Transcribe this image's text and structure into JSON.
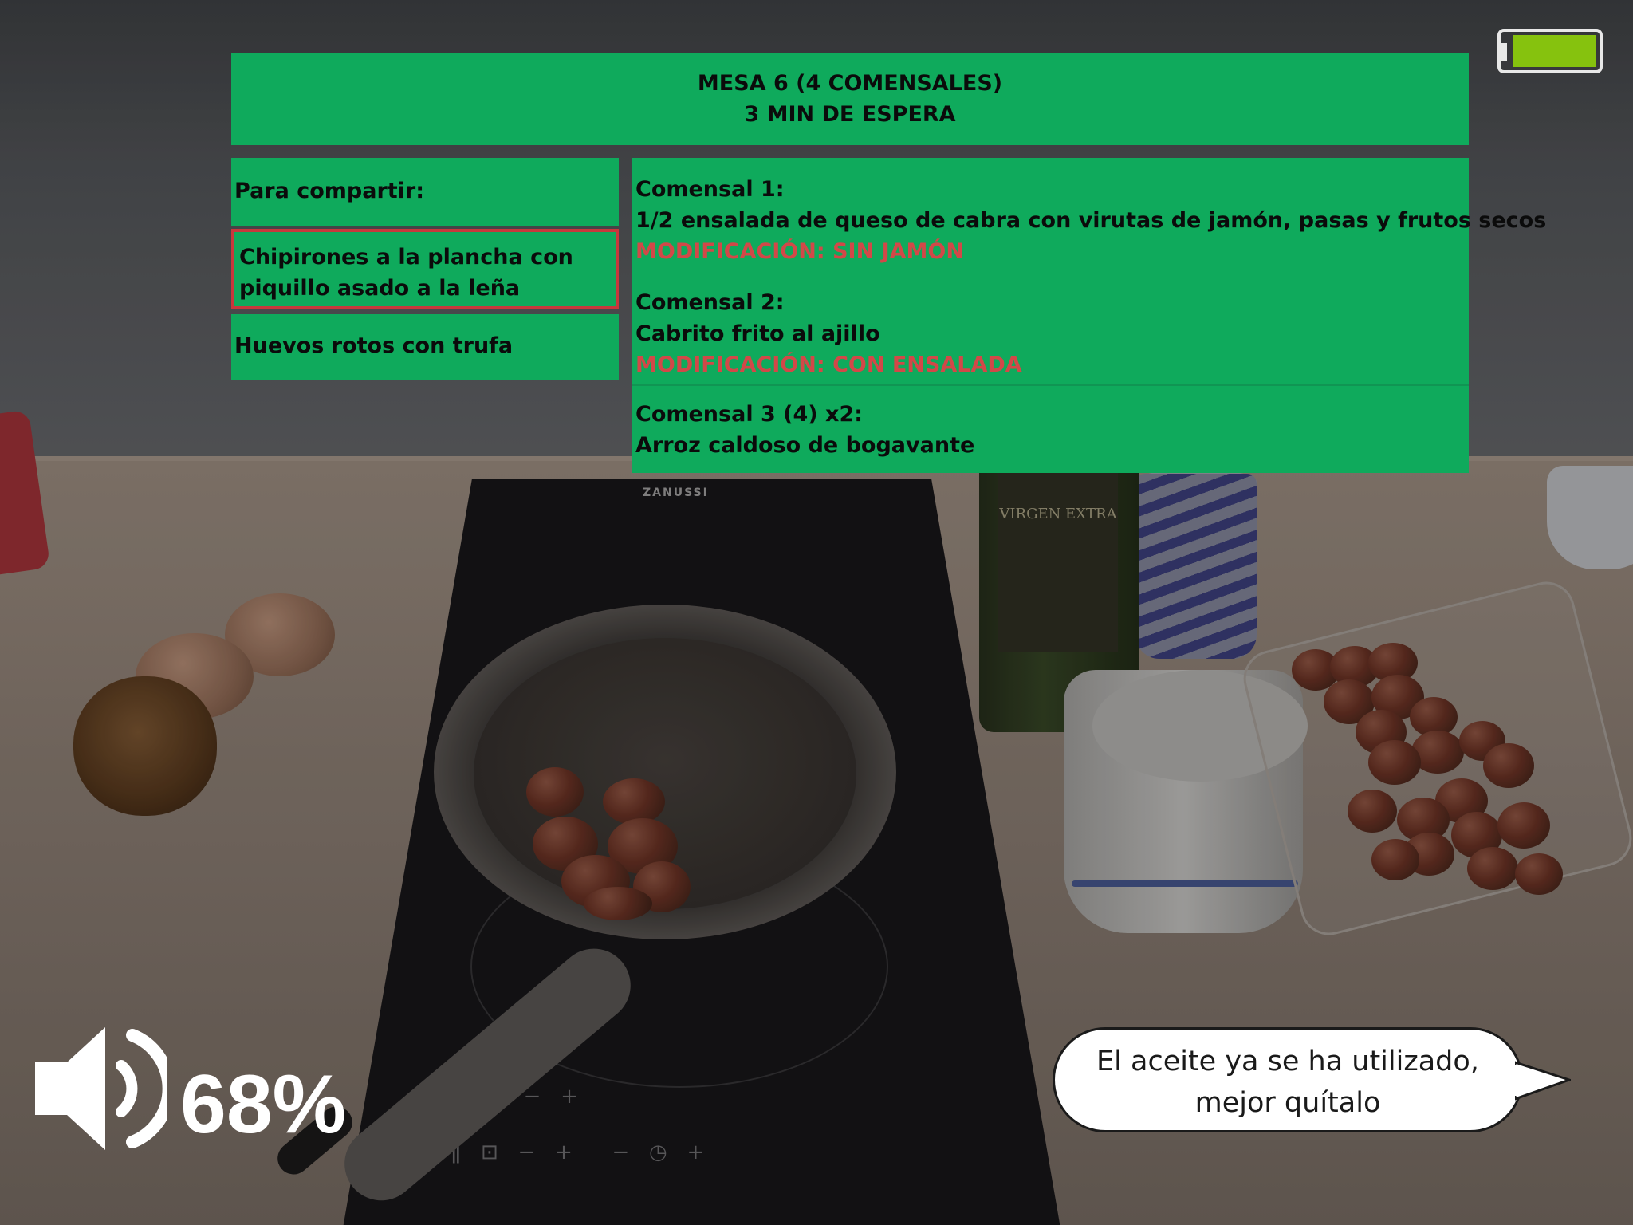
{
  "header": {
    "line1": "MESA 6 (4 COMENSALES)",
    "line2": "3 MIN DE ESPERA"
  },
  "share": {
    "title": "Para compartir:",
    "items": [
      {
        "label": "Chipirones a la plancha con piquillo asado a la leña",
        "highlighted": true
      },
      {
        "label": "Huevos rotos con trufa",
        "highlighted": false
      }
    ]
  },
  "diners": [
    {
      "name": "Comensal 1:",
      "dish": "1/2 ensalada de queso de cabra con virutas de jamón, pasas y frutos secos",
      "modification": "MODIFICACIÓN: SIN JAMÓN"
    },
    {
      "name": "Comensal 2:",
      "dish": "Cabrito frito al ajillo",
      "modification": "MODIFICACIÓN: CON ENSALADA"
    },
    {
      "name": "Comensal 3 (4) x2:",
      "dish": "Arroz caldoso de bogavante"
    }
  ],
  "status": {
    "battery_level": 1.0,
    "volume_label": "68%"
  },
  "assistant": {
    "message": "El aceite ya se ha utilizado, mejor quítalo"
  },
  "scene": {
    "hob_brand": "ZANUSSI",
    "bottle_label": "VIRGEN EXTRA"
  },
  "colors": {
    "panel": "#0faa5c",
    "modification": "#d24848",
    "highlight_border": "#c8383c",
    "battery": "#86c20e"
  }
}
